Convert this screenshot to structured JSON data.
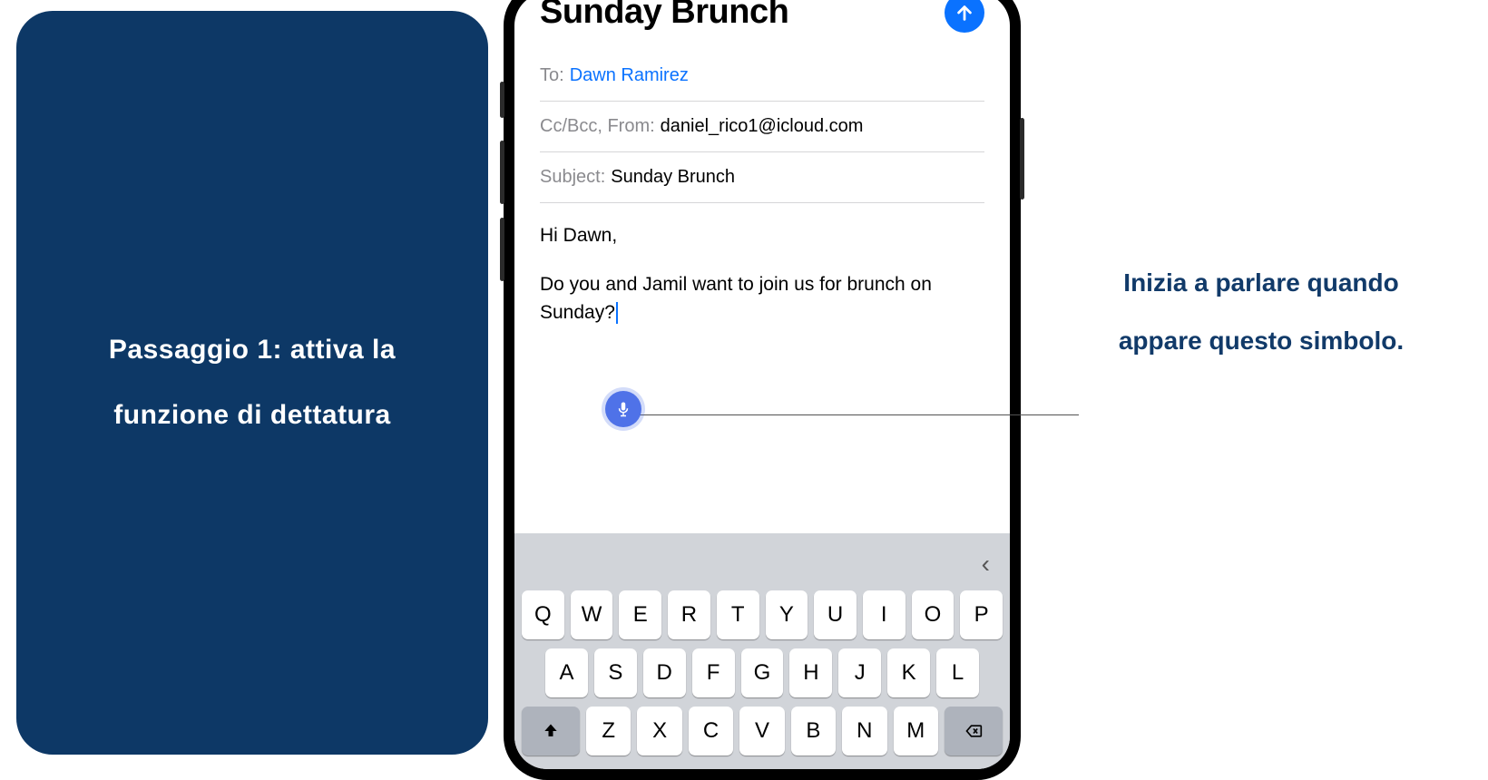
{
  "leftPanel": {
    "text": "Passaggio 1: attiva la funzione di dettatura"
  },
  "rightPanel": {
    "text": "Inizia a parlare quando appare questo simbolo."
  },
  "email": {
    "title": "Sunday Brunch",
    "to_label": "To:",
    "to_value": "Dawn Ramirez",
    "ccbcc_label": "Cc/Bcc, From:",
    "from_value": "daniel_rico1@icloud.com",
    "subject_label": "Subject:",
    "subject_value": "Sunday Brunch",
    "body_greeting": "Hi Dawn,",
    "body_text": "Do you and Jamil want to join us for brunch on Sunday?"
  },
  "keyboard": {
    "row1": [
      "Q",
      "W",
      "E",
      "R",
      "T",
      "Y",
      "U",
      "I",
      "O",
      "P"
    ],
    "row2": [
      "A",
      "S",
      "D",
      "F",
      "G",
      "H",
      "J",
      "K",
      "L"
    ],
    "row3": [
      "Z",
      "X",
      "C",
      "V",
      "B",
      "N",
      "M"
    ]
  }
}
